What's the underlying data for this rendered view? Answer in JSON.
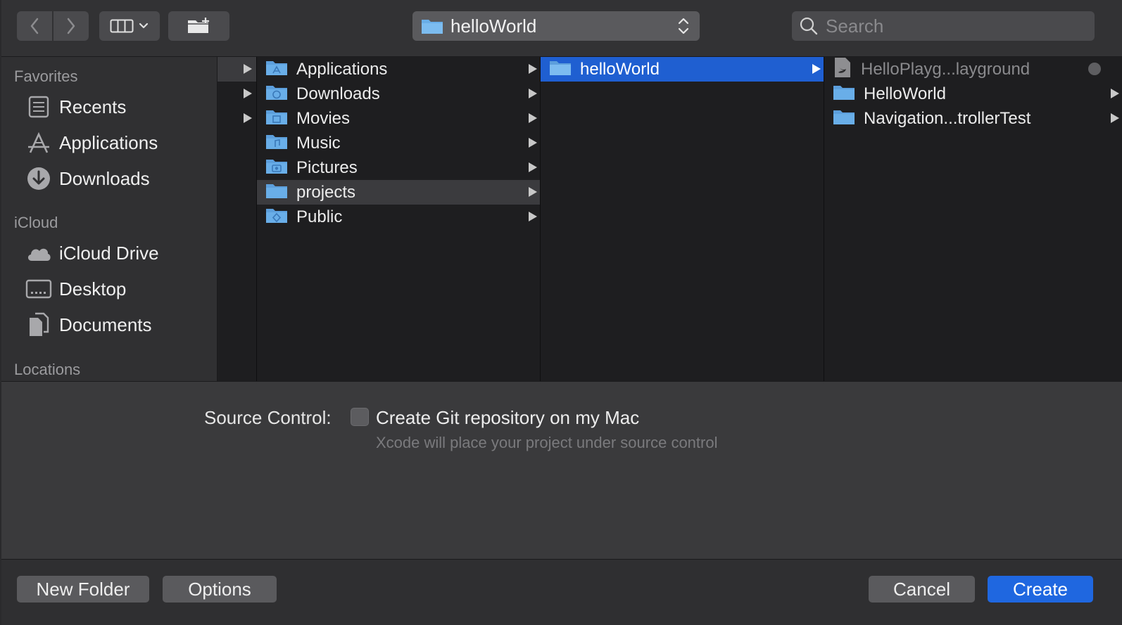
{
  "toolbar": {
    "path_label": "helloWorld",
    "search_placeholder": "Search"
  },
  "sidebar": {
    "favorites_heading": "Favorites",
    "favorites": [
      {
        "label": "Recents",
        "icon": "recents-icon"
      },
      {
        "label": "Applications",
        "icon": "applications-icon"
      },
      {
        "label": "Downloads",
        "icon": "downloads-icon"
      }
    ],
    "icloud_heading": "iCloud",
    "icloud": [
      {
        "label": "iCloud Drive",
        "icon": "cloud-icon"
      },
      {
        "label": "Desktop",
        "icon": "desktop-icon"
      },
      {
        "label": "Documents",
        "icon": "documents-icon"
      }
    ],
    "locations_heading": "Locations"
  },
  "columns": {
    "col2": [
      "Applications",
      "Downloads",
      "Movies",
      "Music",
      "Pictures",
      "projects",
      "Public"
    ],
    "col3": [
      "helloWorld"
    ],
    "col4": [
      "HelloPlayg...layground",
      "HelloWorld",
      "Navigation...trollerTest"
    ]
  },
  "panel": {
    "source_control_label": "Source Control:",
    "checkbox_label": "Create Git repository on my Mac",
    "checkbox_checked": false,
    "checkbox_note": "Xcode will place your project under source control"
  },
  "buttons": {
    "new_folder": "New Folder",
    "options": "Options",
    "cancel": "Cancel",
    "create": "Create"
  },
  "colors": {
    "accent": "#1f5fd1",
    "primary_button": "#1f67e0",
    "folder": "#69aee8"
  }
}
